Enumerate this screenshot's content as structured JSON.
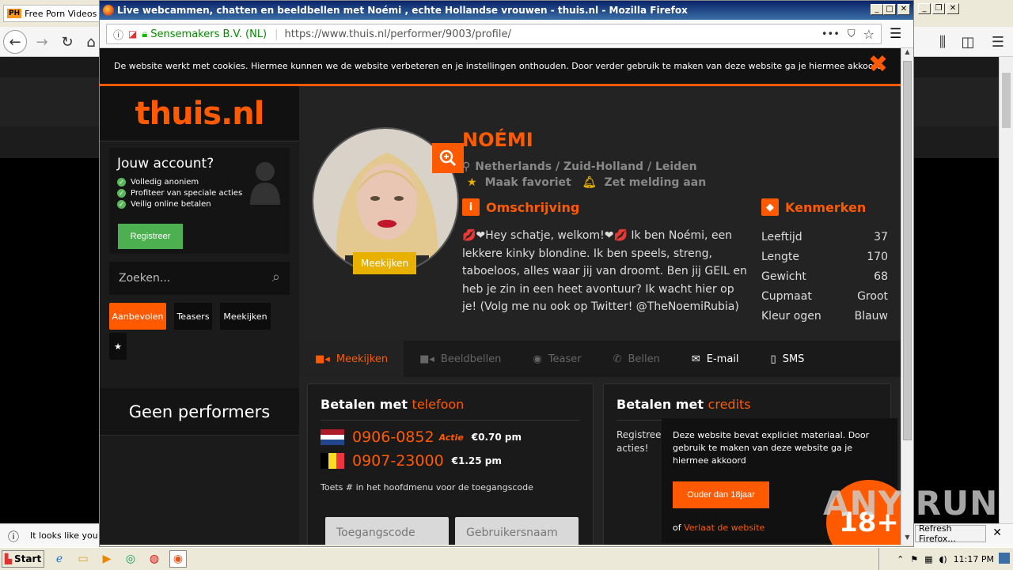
{
  "bg_browser": {
    "tab_label": "Free Porn Videos &",
    "tab_badge": "PH",
    "notification": "It looks like you ha",
    "refresh_label": "Refresh Firefox..."
  },
  "window": {
    "title": "Live webcammen, chatten en beeldbellen met Noémi , echte Hollandse vrouwen - thuis.nl - Mozilla Firefox",
    "min": "_",
    "max": "□",
    "close": "✕"
  },
  "urlbar": {
    "identity": "Sensemakers B.V. (NL)",
    "url": "https://www.thuis.nl/performer/9003/profile/"
  },
  "cookie": {
    "text": "De website werkt met cookies. Hiermee kunnen we de website verbeteren en je instellingen onthouden. Door verder gebruik te maken van deze website ga je hiermee akkoord.",
    "close": "✖"
  },
  "sidebar": {
    "logo": "thuis.nl",
    "account_title": "Jouw account?",
    "benefits": [
      "Volledig anoniem",
      "Profiteer van speciale acties",
      "Veilig online betalen"
    ],
    "register_label": "Registreer",
    "search_placeholder": "Zoeken...",
    "tabs": [
      "Aanbevolen",
      "Teasers",
      "Meekijken",
      "★"
    ],
    "empty_text": "Geen performers"
  },
  "profile": {
    "name": "NOÉMI",
    "location": "Netherlands / Zuid-Holland / Leiden",
    "favorite": "Maak favoriet",
    "notify": "Zet melding aan",
    "meekijken_badge": "Meekijken",
    "description_title": "Omschrijving",
    "description": "💋❤Hey schatje, welkom!❤💋 Ik ben Noémi, een lekkere kinky blondine. Ik ben speels, streng, taboeloos, alles waar jij van droomt. Ben jij GEIL en heb je zin in een heet avontuur? Ik wacht hier op je! (Volg me nu ook op Twitter! @TheNoemiRubia)",
    "features_title": "Kenmerken",
    "features": [
      {
        "label": "Leeftijd",
        "value": "37"
      },
      {
        "label": "Lengte",
        "value": "170"
      },
      {
        "label": "Gewicht",
        "value": "68"
      },
      {
        "label": "Cupmaat",
        "value": "Groot"
      },
      {
        "label": "Kleur ogen",
        "value": "Blauw"
      }
    ]
  },
  "contact_tabs": [
    {
      "label": "Meekijken",
      "icon": "video-icon"
    },
    {
      "label": "Beeldbellen",
      "icon": "video-icon"
    },
    {
      "label": "Teaser",
      "icon": "eye-icon"
    },
    {
      "label": "Bellen",
      "icon": "phone-icon"
    },
    {
      "label": "E-mail",
      "icon": "mail-icon"
    },
    {
      "label": "SMS",
      "icon": "mobile-icon"
    }
  ],
  "pay_phone": {
    "title_prefix": "Betalen met",
    "title_accent": "telefoon",
    "nl_number": "0906-0852",
    "nl_action": "Actie",
    "nl_price": "€0.70 pm",
    "be_number": "0907-23000",
    "be_price": "€1.25 pm",
    "hint": "Toets # in het hoofdmenu voor de toegangscode",
    "code_placeholder": "Toegangscode",
    "user_placeholder": "Gebruikersnaam"
  },
  "pay_credits": {
    "title_prefix": "Betalen met",
    "title_accent": "credits",
    "text1": "Registreer",
    "text2": "acties!"
  },
  "age_popup": {
    "text": "Deze website bevat expliciet materiaal. Door gebruik te maken van deze website ga je hiermee akkoord",
    "button": "Ouder dan 18jaar",
    "or": "of",
    "leave": "Verlaat de website",
    "badge": "18+"
  },
  "watermark": "ANY RUN",
  "taskbar": {
    "start": "Start",
    "time": "11:17 PM"
  },
  "colors": {
    "accent": "#ff5a00",
    "success": "#4caf50",
    "meek": "#e8b100"
  }
}
